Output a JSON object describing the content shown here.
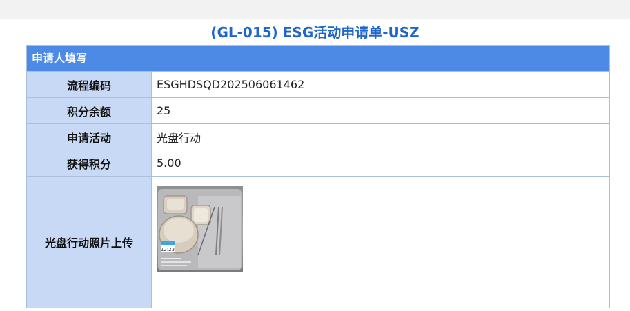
{
  "title": "(GL-015) ESG活动申请单-USZ",
  "section": {
    "header": "申请人填写"
  },
  "fields": [
    {
      "label": "流程编码",
      "value": "ESGHDSQD202506061462"
    },
    {
      "label": "积分余额",
      "value": "25"
    },
    {
      "label": "申请活动",
      "value": "光盘行动"
    },
    {
      "label": "获得积分",
      "value": "5.00"
    }
  ],
  "photo": {
    "label": "光盘行动照片上传",
    "stamp_time": "12:23"
  },
  "colors": {
    "title": "#1f66c9",
    "header_bg": "#4d8ae6",
    "label_bg": "#c8d9f5",
    "border": "#a9c0dc"
  }
}
